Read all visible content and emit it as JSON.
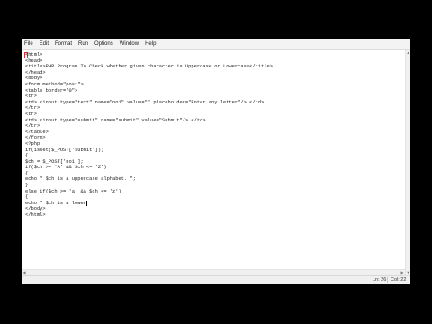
{
  "menu": [
    "File",
    "Edit",
    "Format",
    "Run",
    "Options",
    "Window",
    "Help"
  ],
  "code_lines": [
    "<html>",
    "<head>",
    "<title>PHP Program To Check whether given character is Uppercase or Lowercase</title>",
    "</head>",
    "<body>",
    "<form method=\"post\">",
    "<table border=\"0\">",
    "<tr>",
    "<td> <input type=\"text\" name=\"no1\" value=\"\" placeholder=\"Enter any letter\"/> </td>",
    "</tr>",
    "<tr>",
    "<td> <input type=\"submit\" name=\"submit\" value=\"Submit\"/> </td>",
    "</tr>",
    "</table>",
    "</form>",
    "<?php",
    "if(isset($_POST['submit']))",
    "{",
    "$ch = $_POST['no1'];",
    "if($ch >= 'A' && $ch <= 'Z')",
    "{",
    "echo \" $ch is a uppercase alphabet. \";",
    "}",
    "else if($ch >= 'a' && $ch <= 'z')",
    "{",
    "echo \" $ch is a lower",
    "</body>",
    "</html>"
  ],
  "status": {
    "line": "Ln: 26",
    "col": "Col: 22"
  }
}
